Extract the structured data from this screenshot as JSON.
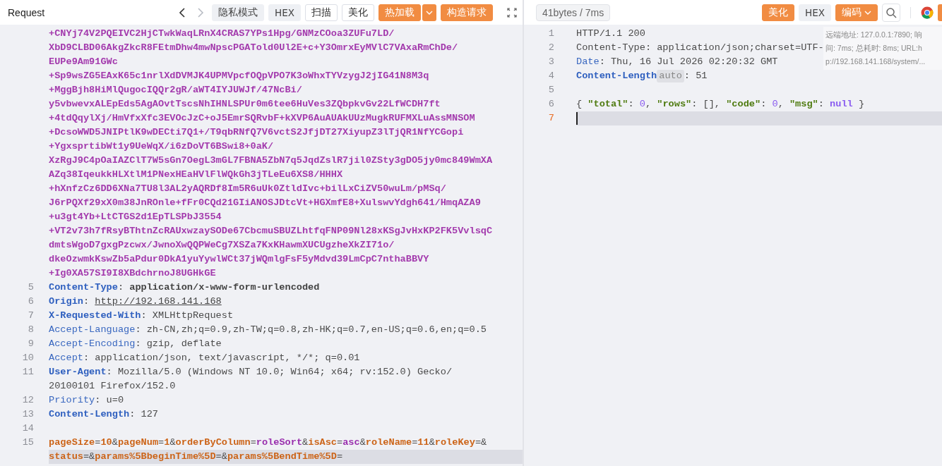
{
  "request_panel": {
    "title": "Request",
    "nav": [
      {
        "kind": "back",
        "disabled": false
      },
      {
        "kind": "forward",
        "disabled": true
      }
    ],
    "buttons": [
      {
        "label": "隐私模式",
        "kind": "filled"
      },
      {
        "label": "HEX",
        "kind": "filled"
      },
      {
        "label": "扫描",
        "kind": "outline"
      },
      {
        "label": "美化",
        "kind": "outline"
      },
      {
        "label": "热加载",
        "kind": "split"
      },
      {
        "label": "构造请求",
        "kind": "primary"
      }
    ],
    "rows": [
      {
        "current": false,
        "tokens": [
          {
            "kind": "cipher",
            "text": "+CNYj74V2PQEIVC2HjCTwkWaqLRnX4CRAS7YPs1Hpg/GNMzCOoa3ZUFu7LD/"
          }
        ]
      },
      {
        "current": false,
        "tokens": [
          {
            "kind": "cipher",
            "text": "XbD9CLBD06AkgZkcR8FEtmDhw4mwNpscPGATold0Ul2E+c+Y3OmrxEyMVlC7VAxaRmChDe/"
          }
        ]
      },
      {
        "current": false,
        "tokens": [
          {
            "kind": "cipher",
            "text": "EUPe9Am91GWc"
          }
        ]
      },
      {
        "current": false,
        "tokens": [
          {
            "kind": "cipher",
            "text": "+Sp9wsZG5EAxK65c1nrlXdDVMJK4UPMVpcfOQpVPO7K3oWhxTYVzygJ2jIG41N8M3q"
          }
        ]
      },
      {
        "current": false,
        "tokens": [
          {
            "kind": "cipher",
            "text": "+MggBjh8HiMlQugocIQQr2gR/aWT4IYJUWJf/47NcBi/"
          }
        ]
      },
      {
        "current": false,
        "tokens": [
          {
            "kind": "cipher",
            "text": "y5vbwevxALEpEds5AgAOvtTscsNhIHNLSPUr0m6tee6HuVes3ZQbpkvGv22LfWCDH7ft"
          }
        ]
      },
      {
        "current": false,
        "tokens": [
          {
            "kind": "cipher",
            "text": "+4tdQqylXj/HmVfxXfc3EVOcJzC+oJ5EmrSQRvbF+kXVP6AuAUAkUUzMugkRUFMXLuAssMNSOM"
          }
        ]
      },
      {
        "current": false,
        "tokens": [
          {
            "kind": "cipher",
            "text": "+DcsoWWD5JNIPtlK9wDECti7Q1+/T9qbRNfQ7V6vctS2JfjDT27XiyupZ3lTjQR1NfYCGopi"
          }
        ]
      },
      {
        "current": false,
        "tokens": [
          {
            "kind": "cipher",
            "text": "+YgxsprtibWt1y9UeWqX/i6zDoVT6BSwi8+0aK/"
          }
        ]
      },
      {
        "current": false,
        "tokens": [
          {
            "kind": "cipher",
            "text": "XzRgJ9C4pOaIAZClT7W5sGn7OegL3mGL7FBNA5ZbN7q5JqdZslR7jil0ZSty3gDO5jy0mc849WmXA"
          }
        ]
      },
      {
        "current": false,
        "tokens": [
          {
            "kind": "cipher",
            "text": "AZq38IqeukkHLXtlM1PNexHEaHVlFlWQkGh3jTLeEu6XS8/HHHX"
          }
        ]
      },
      {
        "current": false,
        "tokens": [
          {
            "kind": "cipher",
            "text": "+hXnfzCz6DD6XNa7TU8l3AL2yAQRDf8Im5R6uUk0ZtldIvc+bilLxCiZV50wuLm/pMSq/"
          }
        ]
      },
      {
        "current": false,
        "tokens": [
          {
            "kind": "cipher",
            "text": "J6rPQXf29xX0m38JnROnle+fFr0CQd21GIiANOSJDtcVt+HGXmfE8+XulswvYdgh641/HmqAZA9"
          }
        ]
      },
      {
        "current": false,
        "tokens": [
          {
            "kind": "cipher",
            "text": "+u3gt4Yb+LtCTGS2d1EpTLSPbJ3554"
          }
        ]
      },
      {
        "current": false,
        "tokens": [
          {
            "kind": "cipher",
            "text": "+VT2v73h7fRsyBThtnZcRAUxwzaySODe67CbcmuSBUZLhtfqFNP09Nl28xKSgJvHxKP2FK5VvlsqC"
          }
        ]
      },
      {
        "current": false,
        "tokens": [
          {
            "kind": "cipher",
            "text": "dmtsWgoD7gxgPzcwx/JwnoXwQQPWeCg7XSZa7KxKHawmXUCUgzheXkZI71o/"
          }
        ]
      },
      {
        "current": false,
        "tokens": [
          {
            "kind": "cipher",
            "text": "dkeOzwmkKswZb5aPdur0DkA1yuYywlWCt37jWQmlgFsF5yMdvd39LmCpC7nthaBBVY"
          }
        ]
      },
      {
        "current": false,
        "tokens": [
          {
            "kind": "cipher",
            "text": "+Ig0XA57SI9I8XBdchrnoJ8UGHkGE"
          }
        ]
      },
      {
        "number": "5",
        "current": false,
        "tokens": [
          {
            "kind": "key",
            "text": "Content-Type"
          },
          {
            "kind": "plain",
            "text": ": "
          },
          {
            "kind": "strong",
            "text": "application/x-www-form-urlencoded"
          }
        ]
      },
      {
        "number": "6",
        "current": false,
        "tokens": [
          {
            "kind": "key",
            "text": "Origin"
          },
          {
            "kind": "plain",
            "text": ": "
          },
          {
            "kind": "link",
            "text": "http://192.168.141.168"
          }
        ]
      },
      {
        "number": "7",
        "current": false,
        "tokens": [
          {
            "kind": "key",
            "text": "X-Requested-With"
          },
          {
            "kind": "plain",
            "text": ": XMLHttpRequest"
          }
        ]
      },
      {
        "number": "8",
        "current": false,
        "tokens": [
          {
            "kind": "soft-key",
            "text": "Accept-Language"
          },
          {
            "kind": "plain",
            "text": ": zh-CN,zh;q=0.9,zh-TW;q=0.8,zh-HK;q=0.7,en-US;q=0.6,en;q=0.5"
          }
        ]
      },
      {
        "number": "9",
        "current": false,
        "tokens": [
          {
            "kind": "soft-key",
            "text": "Accept-Encoding"
          },
          {
            "kind": "plain",
            "text": ": gzip, deflate"
          }
        ]
      },
      {
        "number": "10",
        "current": false,
        "tokens": [
          {
            "kind": "soft-key",
            "text": "Accept"
          },
          {
            "kind": "plain",
            "text": ": application/json, text/javascript, */*; q=0.01"
          }
        ]
      },
      {
        "number": "11",
        "current": false,
        "tokens": [
          {
            "kind": "key",
            "text": "User-Agent"
          },
          {
            "kind": "plain",
            "text": ": Mozilla/5.0 (Windows NT 10.0; Win64; x64; rv:152.0) Gecko/"
          }
        ]
      },
      {
        "current": false,
        "tokens": [
          {
            "kind": "plain",
            "text": "20100101 Firefox/152.0"
          }
        ]
      },
      {
        "number": "12",
        "current": false,
        "tokens": [
          {
            "kind": "soft-key",
            "text": "Priority"
          },
          {
            "kind": "plain",
            "text": ": u=0"
          }
        ]
      },
      {
        "number": "13",
        "current": false,
        "tokens": [
          {
            "kind": "key",
            "text": "Content-Length"
          },
          {
            "kind": "plain",
            "text": ": 127"
          }
        ]
      },
      {
        "number": "14",
        "current": false,
        "tokens": []
      },
      {
        "number": "15",
        "current": false,
        "tokens": [
          {
            "kind": "param",
            "text": "pageSize"
          },
          {
            "kind": "plain",
            "text": "="
          },
          {
            "kind": "param",
            "text": "10"
          },
          {
            "kind": "plain",
            "text": "&"
          },
          {
            "kind": "param",
            "text": "pageNum"
          },
          {
            "kind": "plain",
            "text": "="
          },
          {
            "kind": "param",
            "text": "1"
          },
          {
            "kind": "plain",
            "text": "&"
          },
          {
            "kind": "param",
            "text": "orderByColumn"
          },
          {
            "kind": "plain",
            "text": "="
          },
          {
            "kind": "value",
            "text": "roleSort"
          },
          {
            "kind": "plain",
            "text": "&"
          },
          {
            "kind": "param",
            "text": "isAsc"
          },
          {
            "kind": "plain",
            "text": "="
          },
          {
            "kind": "value",
            "text": "asc"
          },
          {
            "kind": "plain",
            "text": "&"
          },
          {
            "kind": "param",
            "text": "roleName"
          },
          {
            "kind": "plain",
            "text": "="
          },
          {
            "kind": "param",
            "text": "11"
          },
          {
            "kind": "plain",
            "text": "&"
          },
          {
            "kind": "param",
            "text": "roleKey"
          },
          {
            "kind": "plain",
            "text": "=&"
          }
        ]
      },
      {
        "current": true,
        "tokens": [
          {
            "kind": "param",
            "text": "status"
          },
          {
            "kind": "plain",
            "text": "=&"
          },
          {
            "kind": "param",
            "text": "params%5BbeginTime%5D"
          },
          {
            "kind": "plain",
            "text": "=&"
          },
          {
            "kind": "param",
            "text": "params%5BendTime%5D"
          },
          {
            "kind": "plain",
            "text": "="
          }
        ]
      }
    ]
  },
  "response_panel": {
    "stats": "41bytes / 7ms",
    "focused": true,
    "buttons": [
      {
        "label": "美化",
        "kind": "primary"
      },
      {
        "label": "HEX",
        "kind": "filled"
      },
      {
        "label": "编码",
        "kind": "dropdown"
      }
    ],
    "rows": [
      {
        "number": "1",
        "current": false,
        "tokens": [
          {
            "kind": "plain",
            "text": "HTTP/1.1 200"
          }
        ]
      },
      {
        "number": "2",
        "current": false,
        "tokens": [
          {
            "kind": "plain",
            "text": "Content-Type: application/json;charset=UTF-"
          }
        ]
      },
      {
        "number": "3",
        "current": false,
        "tokens": [
          {
            "kind": "soft-key",
            "text": "Date"
          },
          {
            "kind": "plain",
            "text": ": Thu, 16 Jul 2026 02:20:32 GMT"
          }
        ]
      },
      {
        "number": "4",
        "current": false,
        "tokens": [
          {
            "kind": "key",
            "text": "Content-Length"
          },
          {
            "kind": "badge",
            "text": "auto"
          },
          {
            "kind": "plain",
            "text": ": 51"
          }
        ]
      },
      {
        "number": "5",
        "current": false,
        "tokens": []
      },
      {
        "number": "6",
        "current": false,
        "tokens": [
          {
            "kind": "plain",
            "text": "{ "
          },
          {
            "kind": "json-key",
            "text": "\"total\""
          },
          {
            "kind": "plain",
            "text": ": "
          },
          {
            "kind": "json-num",
            "text": "0"
          },
          {
            "kind": "plain",
            "text": ", "
          },
          {
            "kind": "json-key",
            "text": "\"rows\""
          },
          {
            "kind": "plain",
            "text": ": [], "
          },
          {
            "kind": "json-key",
            "text": "\"code\""
          },
          {
            "kind": "plain",
            "text": ": "
          },
          {
            "kind": "json-num",
            "text": "0"
          },
          {
            "kind": "plain",
            "text": ", "
          },
          {
            "kind": "json-key",
            "text": "\"msg\""
          },
          {
            "kind": "plain",
            "text": ": "
          },
          {
            "kind": "json-null",
            "text": "null"
          },
          {
            "kind": "plain",
            "text": " }"
          }
        ]
      },
      {
        "number": "7",
        "current": true,
        "tokens": []
      }
    ],
    "tooltip": [
      "远端地址: 127.0.0.1:7890; 响",
      "间: 7ms; 总耗时: 8ms; URL:h",
      "p://192.168.141.168/system/..."
    ]
  }
}
